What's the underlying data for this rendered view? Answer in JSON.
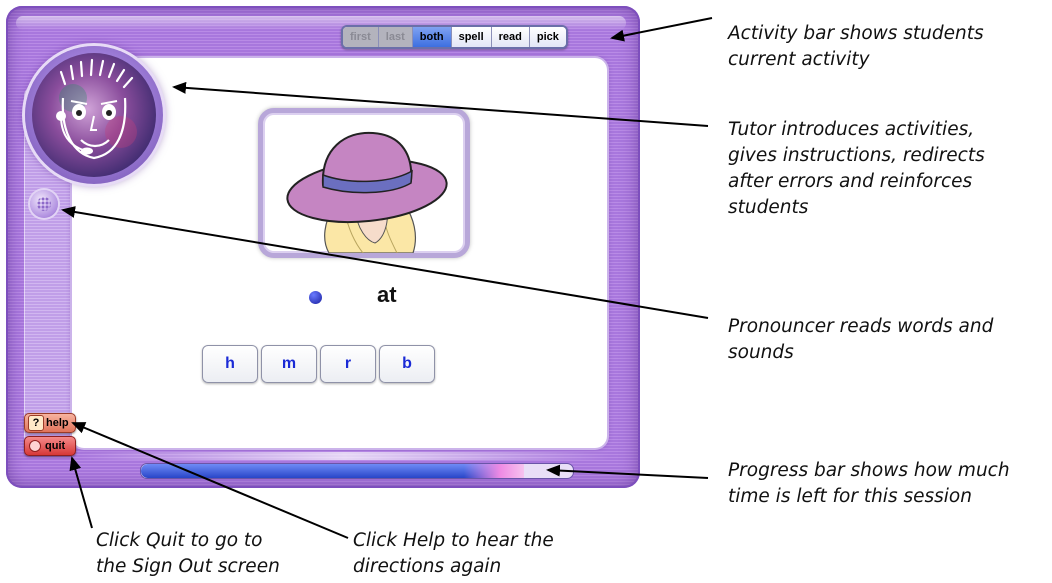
{
  "activity_bar": {
    "items": [
      {
        "label": "first",
        "state": "done"
      },
      {
        "label": "last",
        "state": "done"
      },
      {
        "label": "both",
        "state": "current"
      },
      {
        "label": "spell",
        "state": "pending"
      },
      {
        "label": "read",
        "state": "pending"
      },
      {
        "label": "pick",
        "state": "pending"
      }
    ]
  },
  "exercise": {
    "picture": "hat-icon",
    "word_ending": "at",
    "letter_choices": [
      "h",
      "m",
      "r",
      "b"
    ]
  },
  "controls": {
    "help_label": "help",
    "quit_label": "quit"
  },
  "progress": {
    "fraction_elapsed": 0.84
  },
  "callouts": {
    "activity_bar": [
      "Activity bar shows students",
      "current activity"
    ],
    "tutor": [
      "Tutor introduces activities,",
      "gives instructions, redirects",
      "after errors and reinforces",
      "students"
    ],
    "pronouncer": [
      "Pronouncer reads words and",
      "sounds"
    ],
    "progress": [
      "Progress bar shows how much",
      "time is left for this session"
    ],
    "quit": [
      "Click Quit to go to",
      "the Sign Out screen"
    ],
    "help": [
      "Click Help to hear the",
      "directions again"
    ]
  },
  "colors": {
    "frame_purple": "#a877dd",
    "current_activity": "#3d6fe0",
    "letter_text": "#1a2ad6",
    "progress_fill": "#2846c8"
  }
}
